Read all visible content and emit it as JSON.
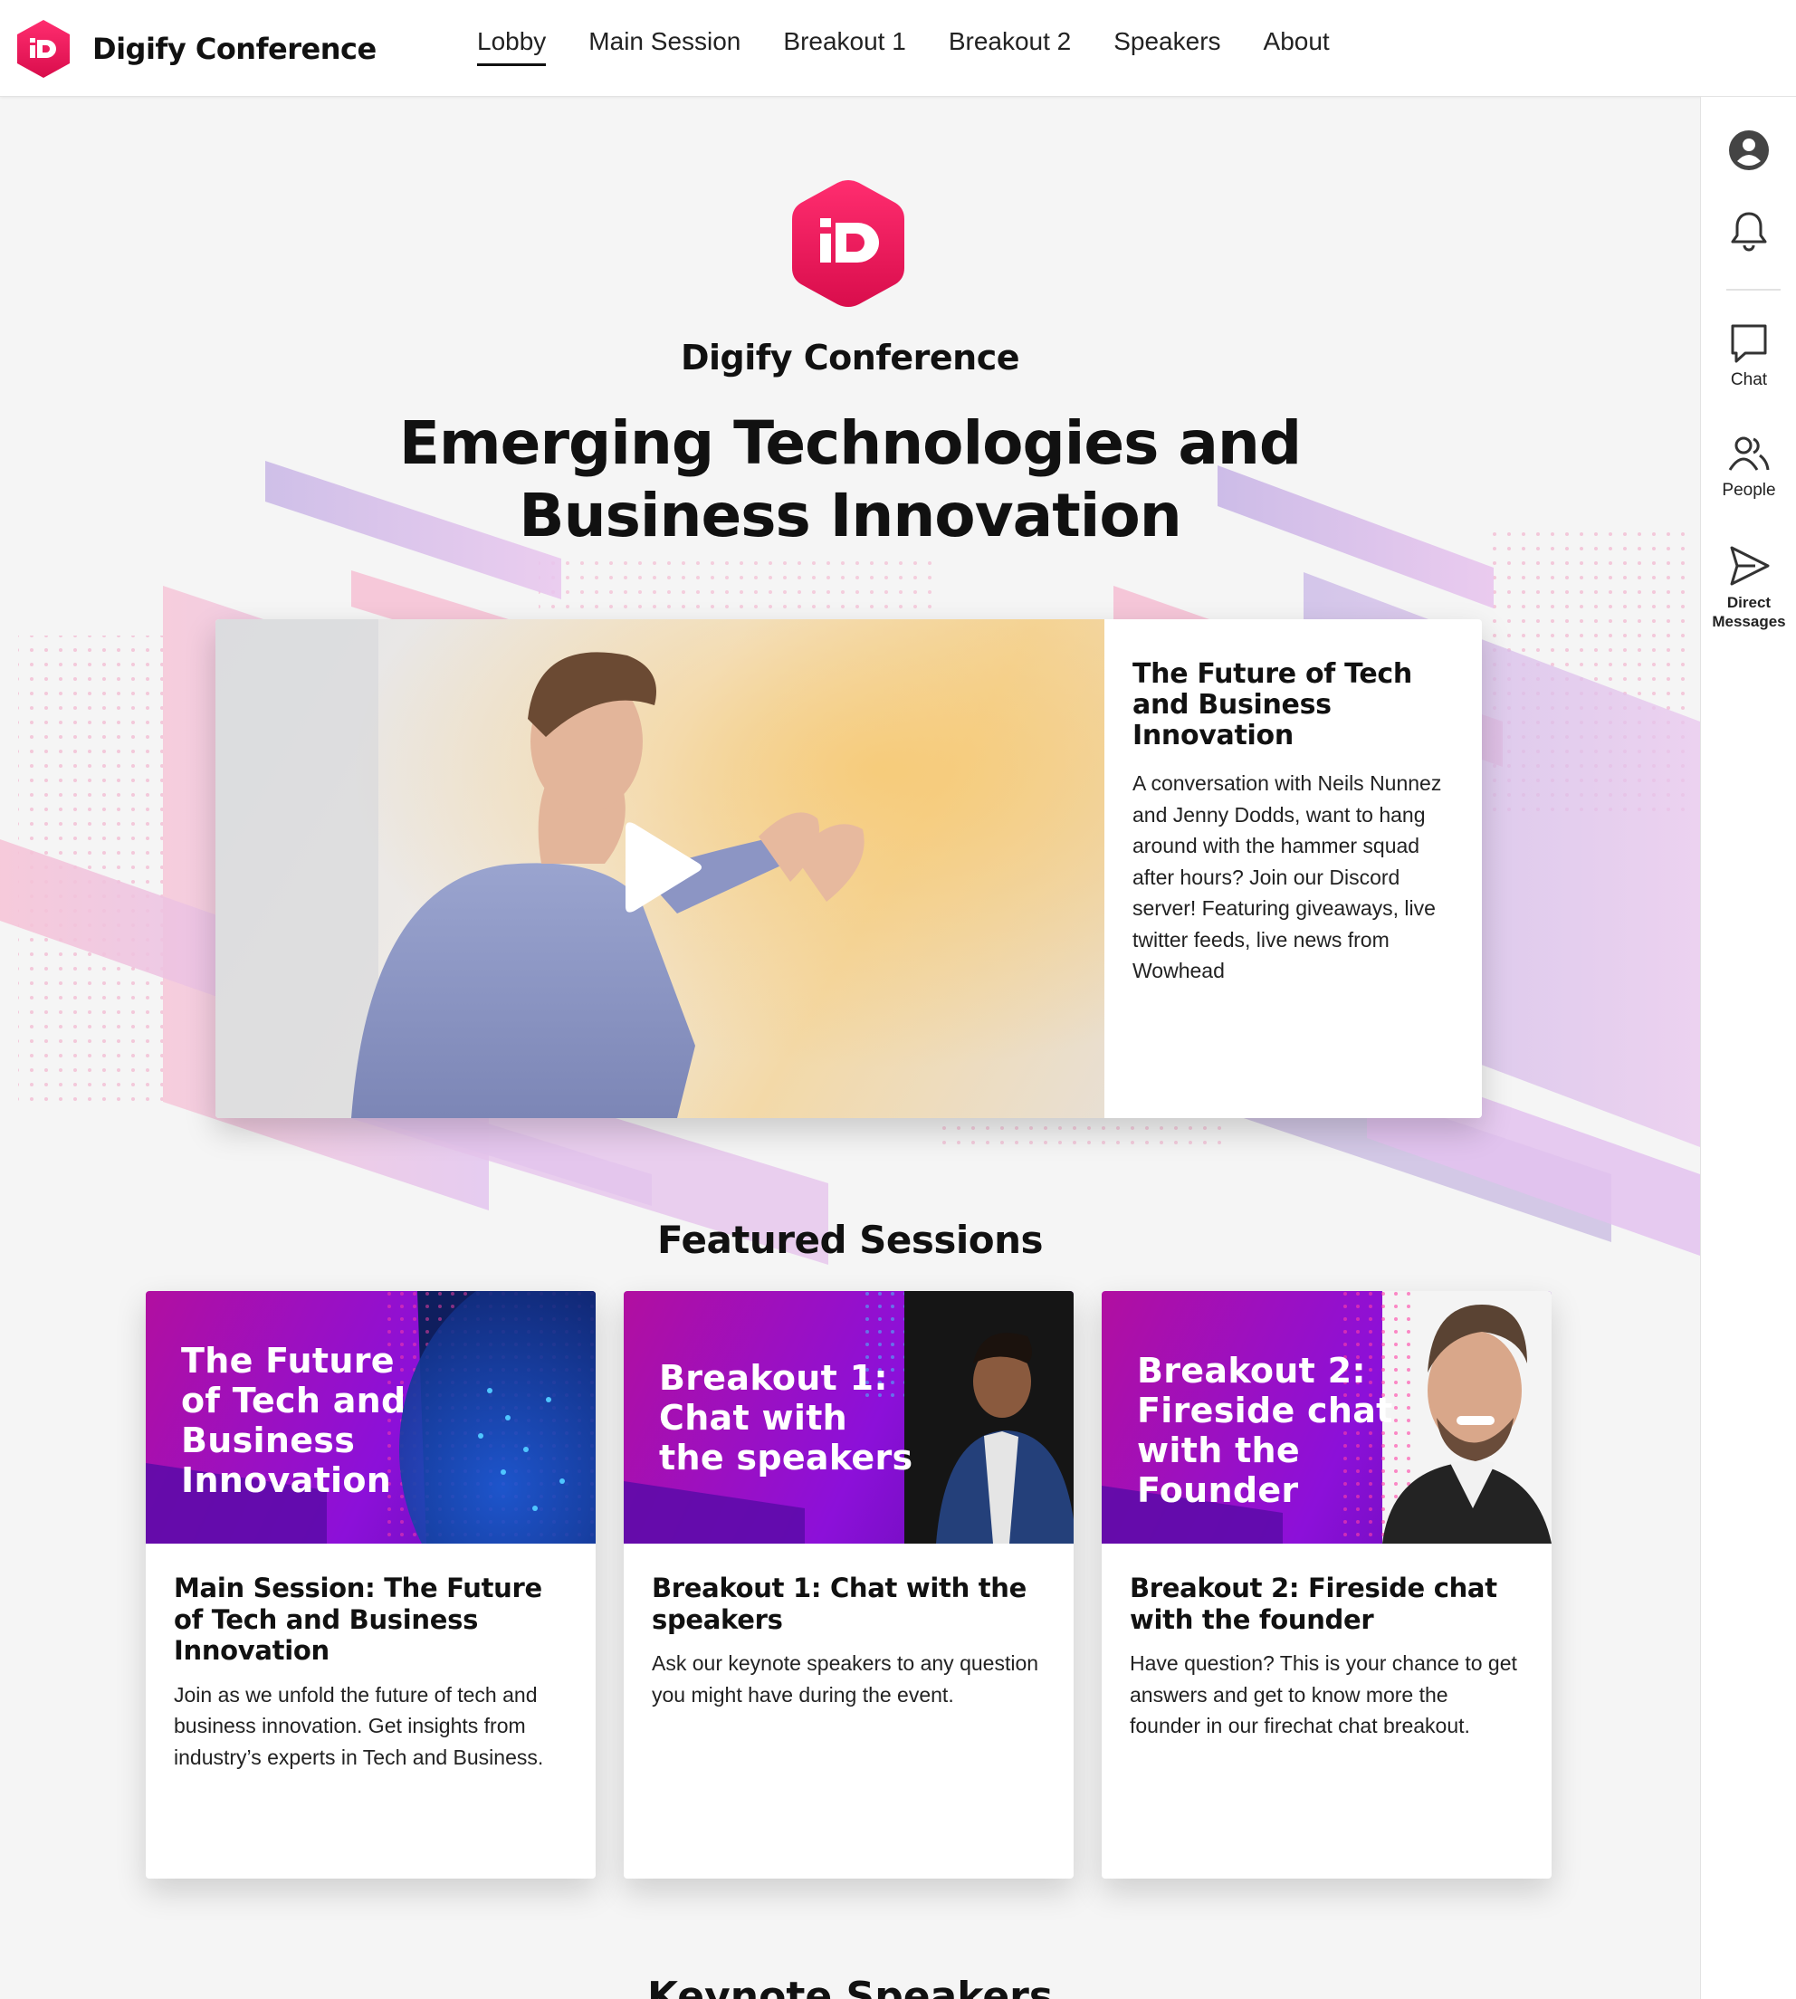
{
  "header": {
    "brand_name": "Digify Conference",
    "logo_letter": "D",
    "nav": [
      {
        "label": "Lobby",
        "active": true
      },
      {
        "label": "Main Session"
      },
      {
        "label": "Breakout 1"
      },
      {
        "label": "Breakout 2"
      },
      {
        "label": "Speakers"
      },
      {
        "label": "About"
      }
    ]
  },
  "rail": {
    "profile_icon": "account-circle-icon",
    "notifications_icon": "bell-icon",
    "items": [
      {
        "label": "Chat",
        "icon": "chat-bubble-icon"
      },
      {
        "label": "People",
        "icon": "people-icon"
      },
      {
        "label_line1": "Direct",
        "label_line2": "Messages",
        "icon": "send-icon"
      }
    ]
  },
  "hero": {
    "brand_name": "Digify Conference",
    "title_line1": "Emerging Technologies and",
    "title_line2": "Business Innovation"
  },
  "feature": {
    "play_icon": "play-icon",
    "title": "The Future of Tech and Business Innovation",
    "description": "A conversation with Neils Nunnez and Jenny Dodds, want to hang around with the hammer squad after hours? Join our Discord server! Featuring giveaways, live twitter feeds, live news from Wowhead"
  },
  "sessions": {
    "heading": "Featured Sessions",
    "cards": [
      {
        "image_title": [
          "The Future",
          "of Tech and",
          "Business",
          "Innovation"
        ],
        "title": "Main Session: The Future of Tech and Business Innovation",
        "description": "Join as we unfold the future of tech and business innovation. Get insights from industry’s experts in Tech and Business."
      },
      {
        "image_title": [
          "Breakout 1:",
          "Chat with",
          "the speakers"
        ],
        "title": "Breakout 1: Chat with the speakers",
        "description": "Ask our keynote speakers to any question you might have during the event."
      },
      {
        "image_title": [
          "Breakout 2:",
          "Fireside chat",
          "with the",
          "Founder"
        ],
        "title": "Breakout 2: Fireside chat with the founder",
        "description": "Have question? This is your chance to get answers and get to know more the founder in our firechat chat breakout."
      }
    ]
  },
  "keynote": {
    "heading": "Keynote Speakers"
  },
  "colors": {
    "brand": "#e8175d",
    "accent_purple": "#8c10d9",
    "accent_magenta": "#b10fa0"
  }
}
